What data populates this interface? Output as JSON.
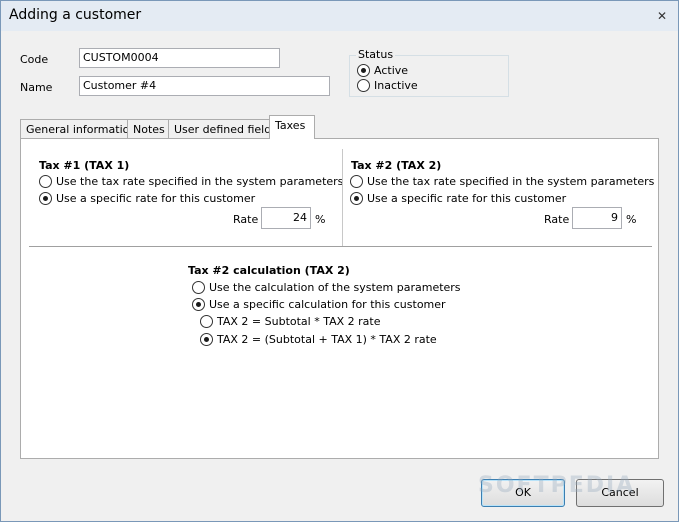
{
  "window": {
    "title": "Adding a customer"
  },
  "header": {
    "code_label": "Code",
    "code_value": "CUSTOM0004",
    "name_label": "Name",
    "name_value": "Customer #4",
    "status": {
      "legend": "Status",
      "active": "Active",
      "inactive": "Inactive",
      "selected": "Active"
    }
  },
  "tabs": [
    {
      "label": "General information"
    },
    {
      "label": "Notes"
    },
    {
      "label": "User defined fields"
    },
    {
      "label": "Taxes",
      "active": true
    }
  ],
  "taxes": {
    "tax1": {
      "title": "Tax #1 (TAX 1)",
      "option_system": "Use the tax rate specified in the system parameters",
      "option_specific": "Use a specific rate for this customer",
      "rate_label": "Rate",
      "rate_value": "24",
      "rate_unit": "%"
    },
    "tax2": {
      "title": "Tax #2 (TAX 2)",
      "option_system": "Use the tax rate specified in the system parameters",
      "option_specific": "Use a specific rate for this customer",
      "rate_label": "Rate",
      "rate_value": "9",
      "rate_unit": "%"
    },
    "calc": {
      "title": "Tax #2 calculation (TAX 2)",
      "option_system": "Use the calculation of the system parameters",
      "option_specific": "Use a specific calculation for this customer",
      "formula_a": "TAX 2 = Subtotal * TAX 2 rate",
      "formula_b": "TAX 2 = (Subtotal + TAX 1) * TAX 2 rate"
    }
  },
  "buttons": {
    "ok": "OK",
    "cancel": "Cancel"
  },
  "watermark": "SOFTPEDIA",
  "icons": {
    "close": "close-icon"
  }
}
